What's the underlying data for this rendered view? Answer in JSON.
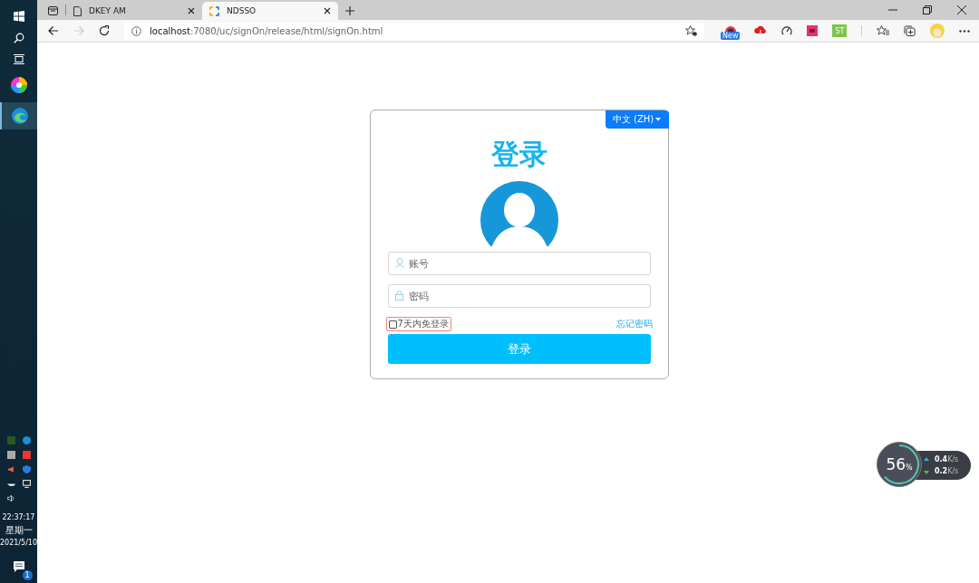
{
  "taskbar": {
    "clock": {
      "time": "22:37:17",
      "weekday": "星期一",
      "date": "2021/5/10"
    },
    "notification_count": "1"
  },
  "browser": {
    "tabs": [
      {
        "title": "DKEY AM",
        "selected": false
      },
      {
        "title": "NDSSO",
        "selected": true
      }
    ],
    "address": {
      "host": "localhost",
      "path": ":7080/uc/signOn/release/html/signOn.html"
    },
    "extension_badge": "New",
    "extension_label": "ST"
  },
  "login": {
    "language": "中文 (ZH)",
    "title": "登录",
    "username": {
      "placeholder": "账号"
    },
    "password": {
      "placeholder": "密码"
    },
    "remember": {
      "label": "7天内免登录",
      "checked": false
    },
    "forgot_link": "忘记密码",
    "submit": "登录"
  },
  "network_widget": {
    "load": "56",
    "load_unit": "%",
    "upload": {
      "value": "0.4",
      "unit": "K/s"
    },
    "download": {
      "value": "0.2",
      "unit": "K/s"
    }
  }
}
